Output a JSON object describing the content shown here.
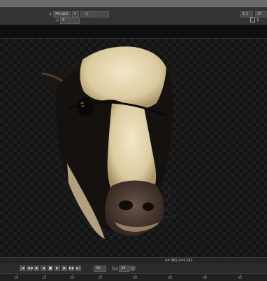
{
  "toolbar": {
    "input_a_label": "A",
    "input_a_value": "Merge1",
    "input_b_label": "B",
    "v_label": "V",
    "v_value": "5",
    "zoom_value": "1:1",
    "frame_value": "20",
    "page_value": "1"
  },
  "viewer": {
    "coord_readout": "x= 982 y=1161"
  },
  "transport": {
    "buttons": [
      "|◀",
      "◀◀",
      "◀|",
      "◀",
      "■",
      "▶",
      "|▶",
      "▶▶",
      "▶|"
    ],
    "frame_field": "20",
    "fps_label": "fps",
    "fps_value": "24"
  },
  "timeline": {
    "ticks": [
      "10",
      "15",
      "20",
      "25",
      "30",
      "35",
      "40",
      "45"
    ]
  },
  "colors": {
    "toolbar_bg": "#333333",
    "viewer_checker_dark": "#141414",
    "viewer_checker_light": "#1d1d1d"
  },
  "icons": [
    "dropdown-icon",
    "lock-icon",
    "play-icon",
    "stop-icon",
    "step-forward-icon",
    "step-back-icon"
  ]
}
